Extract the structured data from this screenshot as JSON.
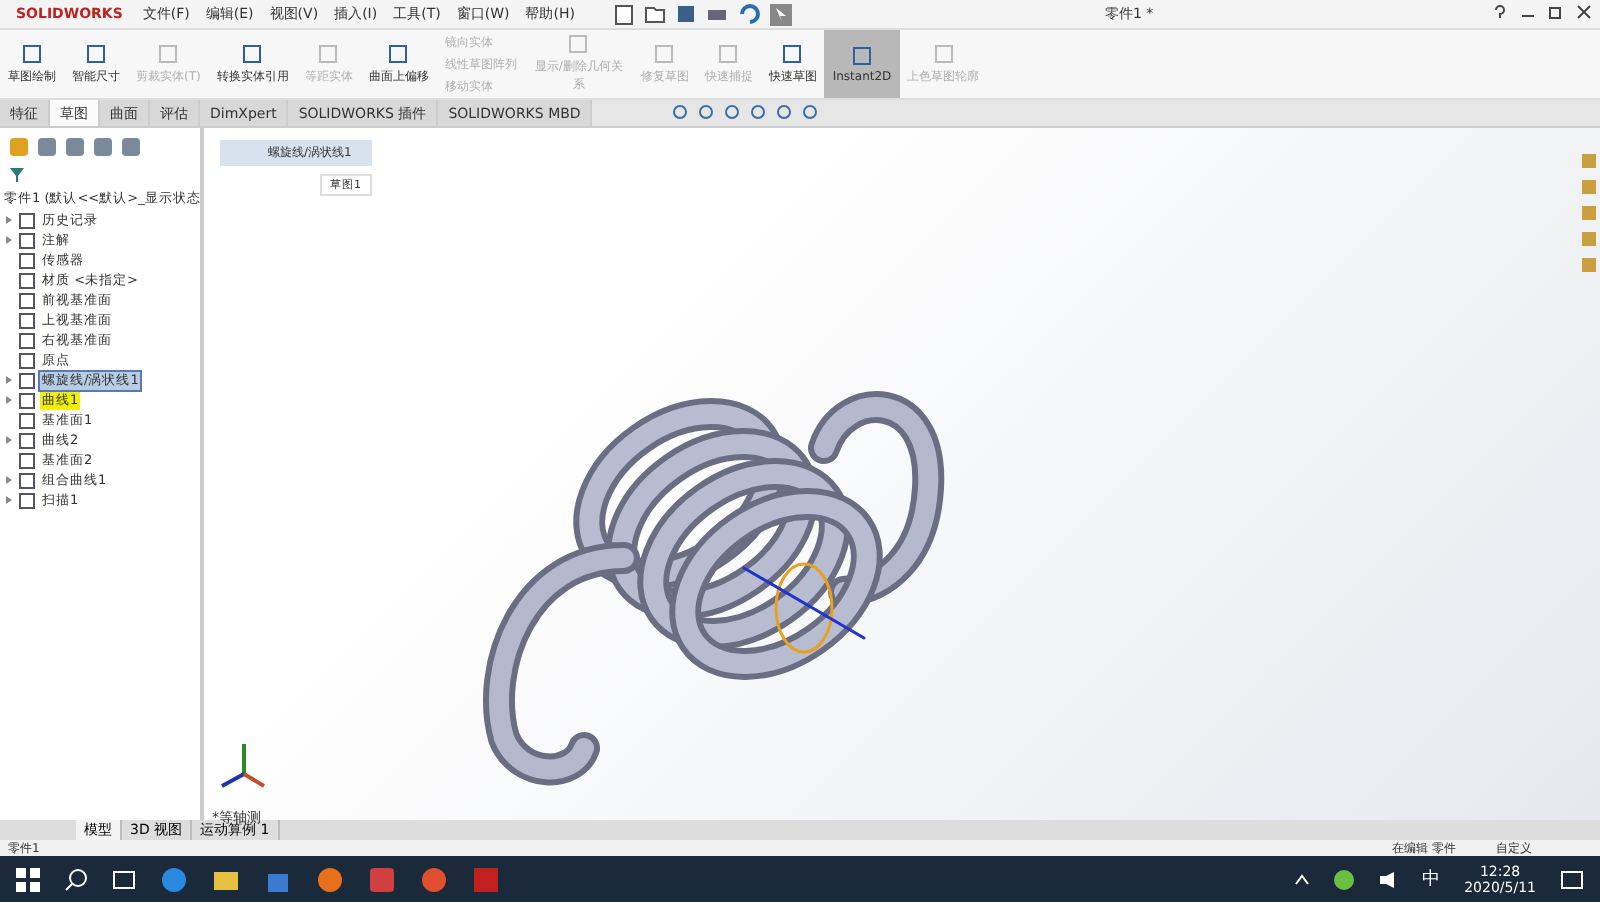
{
  "app": {
    "logo": "SOLIDWORKS",
    "title": "零件1 *",
    "menu": [
      "文件(F)",
      "编辑(E)",
      "视图(V)",
      "插入(I)",
      "工具(T)",
      "窗口(W)",
      "帮助(H)"
    ]
  },
  "ribbon": [
    {
      "label": "草图绘制",
      "disabled": false,
      "selected": false
    },
    {
      "label": "智能尺寸",
      "disabled": false,
      "selected": false
    },
    {
      "label": "剪裁实体(T)",
      "disabled": true,
      "selected": false
    },
    {
      "label": "转换实体引用",
      "disabled": false,
      "selected": false
    },
    {
      "label": "等距实体",
      "disabled": true,
      "selected": false
    },
    {
      "label": "曲面上偏移",
      "disabled": false,
      "selected": false
    },
    {
      "label": "显示/删除几何关系",
      "disabled": true,
      "selected": false
    },
    {
      "label": "修复草图",
      "disabled": true,
      "selected": false
    },
    {
      "label": "快速捕捉",
      "disabled": true,
      "selected": false
    },
    {
      "label": "快速草图",
      "disabled": false,
      "selected": false
    },
    {
      "label": "Instant2D",
      "disabled": false,
      "selected": true
    },
    {
      "label": "上色草图轮廓",
      "disabled": true,
      "selected": false
    }
  ],
  "ribbon_small": [
    "镜向实体",
    "线性草图阵列",
    "移动实体"
  ],
  "tabs": [
    {
      "label": "特征",
      "selected": false
    },
    {
      "label": "草图",
      "selected": true
    },
    {
      "label": "曲面",
      "selected": false
    },
    {
      "label": "评估",
      "selected": false
    },
    {
      "label": "DimXpert",
      "selected": false
    },
    {
      "label": "SOLIDWORKS 插件",
      "selected": false
    },
    {
      "label": "SOLIDWORKS MBD",
      "selected": false
    }
  ],
  "tree": {
    "root": "零件1 (默认<<默认>_显示状态",
    "children": [
      {
        "label": "历史记录",
        "expandable": true,
        "selected": false,
        "highlighted": false
      },
      {
        "label": "注解",
        "expandable": true,
        "selected": false,
        "highlighted": false
      },
      {
        "label": "传感器",
        "expandable": false,
        "selected": false,
        "highlighted": false
      },
      {
        "label": "材质 <未指定>",
        "expandable": false,
        "selected": false,
        "highlighted": false
      },
      {
        "label": "前视基准面",
        "expandable": false,
        "selected": false,
        "highlighted": false
      },
      {
        "label": "上视基准面",
        "expandable": false,
        "selected": false,
        "highlighted": false
      },
      {
        "label": "右视基准面",
        "expandable": false,
        "selected": false,
        "highlighted": false
      },
      {
        "label": "原点",
        "expandable": false,
        "selected": false,
        "highlighted": false
      },
      {
        "label": "螺旋线/涡状线1",
        "expandable": true,
        "selected": true,
        "highlighted": false
      },
      {
        "label": "曲线1",
        "expandable": true,
        "selected": false,
        "highlighted": true
      },
      {
        "label": "基准面1",
        "expandable": false,
        "selected": false,
        "highlighted": false
      },
      {
        "label": "曲线2",
        "expandable": true,
        "selected": false,
        "highlighted": false
      },
      {
        "label": "基准面2",
        "expandable": false,
        "selected": false,
        "highlighted": false
      },
      {
        "label": "组合曲线1",
        "expandable": true,
        "selected": false,
        "highlighted": false
      },
      {
        "label": "扫描1",
        "expandable": true,
        "selected": false,
        "highlighted": false
      }
    ]
  },
  "breadcrumb": [
    "螺旋线/涡状线1",
    "草图1"
  ],
  "view_label": "*等轴测",
  "bottom_tabs": [
    {
      "label": "模型",
      "selected": true
    },
    {
      "label": "3D 视图",
      "selected": false
    },
    {
      "label": "运动算例 1",
      "selected": false
    }
  ],
  "status_bar": {
    "left": "零件1",
    "mode": "在编辑 零件",
    "units": "自定义"
  },
  "taskbar": {
    "ime": "中",
    "time": "12:28",
    "date": "2020/5/11"
  }
}
